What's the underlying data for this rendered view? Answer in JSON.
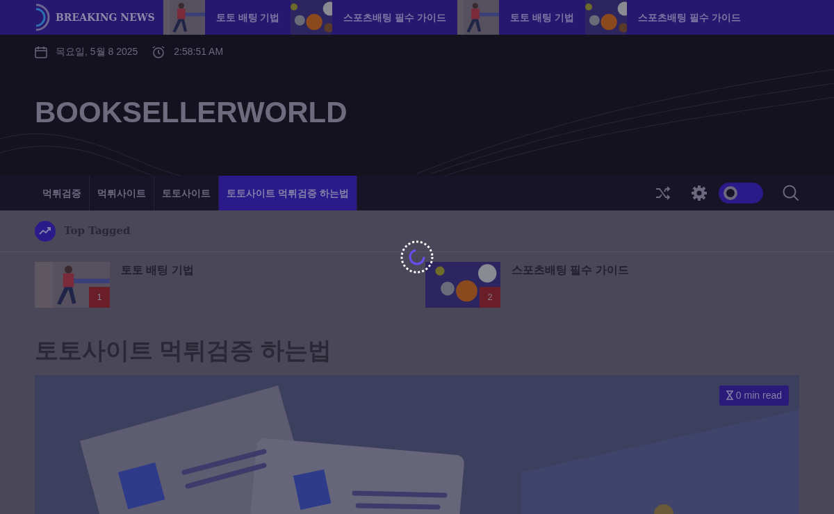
{
  "ticker": {
    "label": "BREAKING NEWS",
    "items": [
      {
        "title": "토토 배팅 기법",
        "kind": "picture"
      },
      {
        "title": "스포츠배팅 필수 가이드",
        "kind": "picture"
      },
      {
        "title": "토토 배팅 기법",
        "kind": "picture"
      },
      {
        "title": "스포츠배팅 필수 가이드",
        "kind": "picture"
      }
    ]
  },
  "header": {
    "date": "목요일, 5월 8 2025",
    "time": "2:58:51 AM",
    "site_title": "BOOKSELLERWORLD"
  },
  "nav": {
    "items": [
      {
        "label": "먹튀검증",
        "selected": false
      },
      {
        "label": "먹튀사이트",
        "selected": false
      },
      {
        "label": "토토사이트",
        "selected": false
      },
      {
        "label": "토토사이트 먹튀검증 하는법",
        "selected": true
      }
    ],
    "theme_toggle": {
      "on": false
    }
  },
  "top_tagged": {
    "heading": "Top Tagged",
    "items": [
      {
        "title": "토토 배팅 기법",
        "rank": "1",
        "kind": "picture"
      },
      {
        "title": "스포츠배팅 필수 가이드",
        "rank": "2",
        "kind": "picture"
      }
    ]
  },
  "article": {
    "title": "토토사이트 먹튀검증 하는법",
    "read_time": "0 min read",
    "kind": "picture"
  }
}
